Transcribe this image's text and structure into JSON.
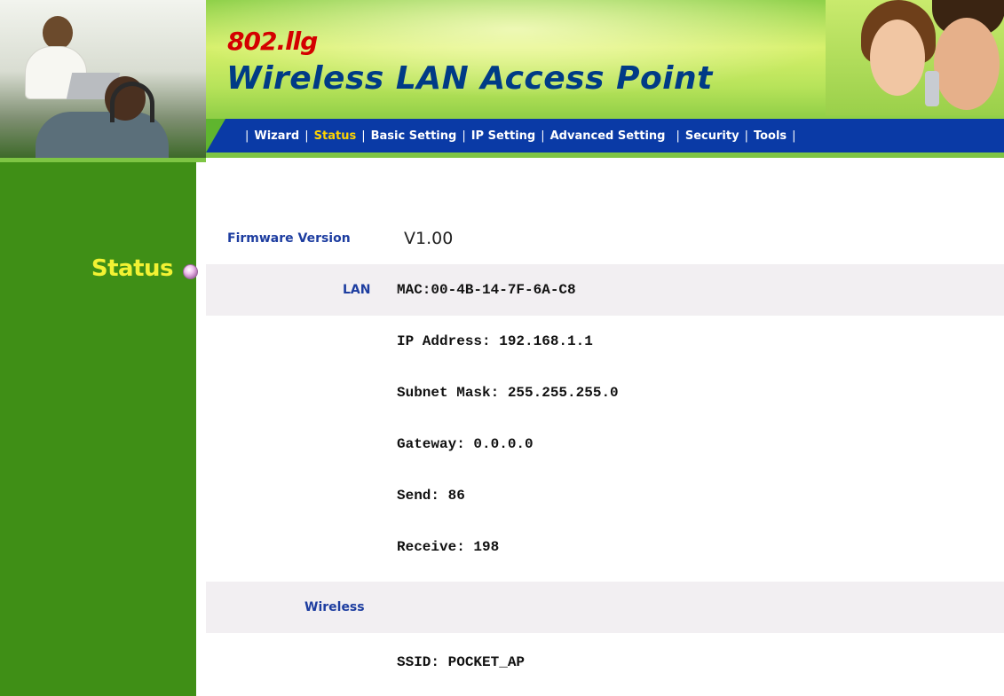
{
  "header": {
    "brand_small": "802.llg",
    "brand_big": "Wireless LAN Access Point"
  },
  "nav": {
    "items": [
      {
        "label": "Wizard",
        "active": false
      },
      {
        "label": "Status",
        "active": true
      },
      {
        "label": "Basic Setting",
        "active": false
      },
      {
        "label": "IP Setting",
        "active": false
      },
      {
        "label": "Advanced Setting",
        "active": false
      },
      {
        "label": "Security",
        "active": false
      },
      {
        "label": "Tools",
        "active": false
      }
    ],
    "separator": "|"
  },
  "sidebar": {
    "title": "Status"
  },
  "status": {
    "firmware_label": "Firmware Version",
    "firmware_value": "V1.00",
    "lan_label": "LAN",
    "lan_mac": "MAC:00-4B-14-7F-6A-C8",
    "ip_address": "IP Address: 192.168.1.1",
    "subnet_mask": "Subnet Mask: 255.255.255.0",
    "gateway": "Gateway: 0.0.0.0",
    "send": "Send: 86",
    "receive": "Receive: 198",
    "wireless_label": "Wireless",
    "ssid": "SSID: POCKET_AP"
  },
  "colors": {
    "nav_bar": "#0a3aa6",
    "nav_active": "#ffd400",
    "sidebar_green": "#3f8f16",
    "label_blue": "#1d3da0",
    "row_shade": "#f2eff2",
    "brand_red": "#d40000",
    "brand_blue": "#003b86"
  }
}
